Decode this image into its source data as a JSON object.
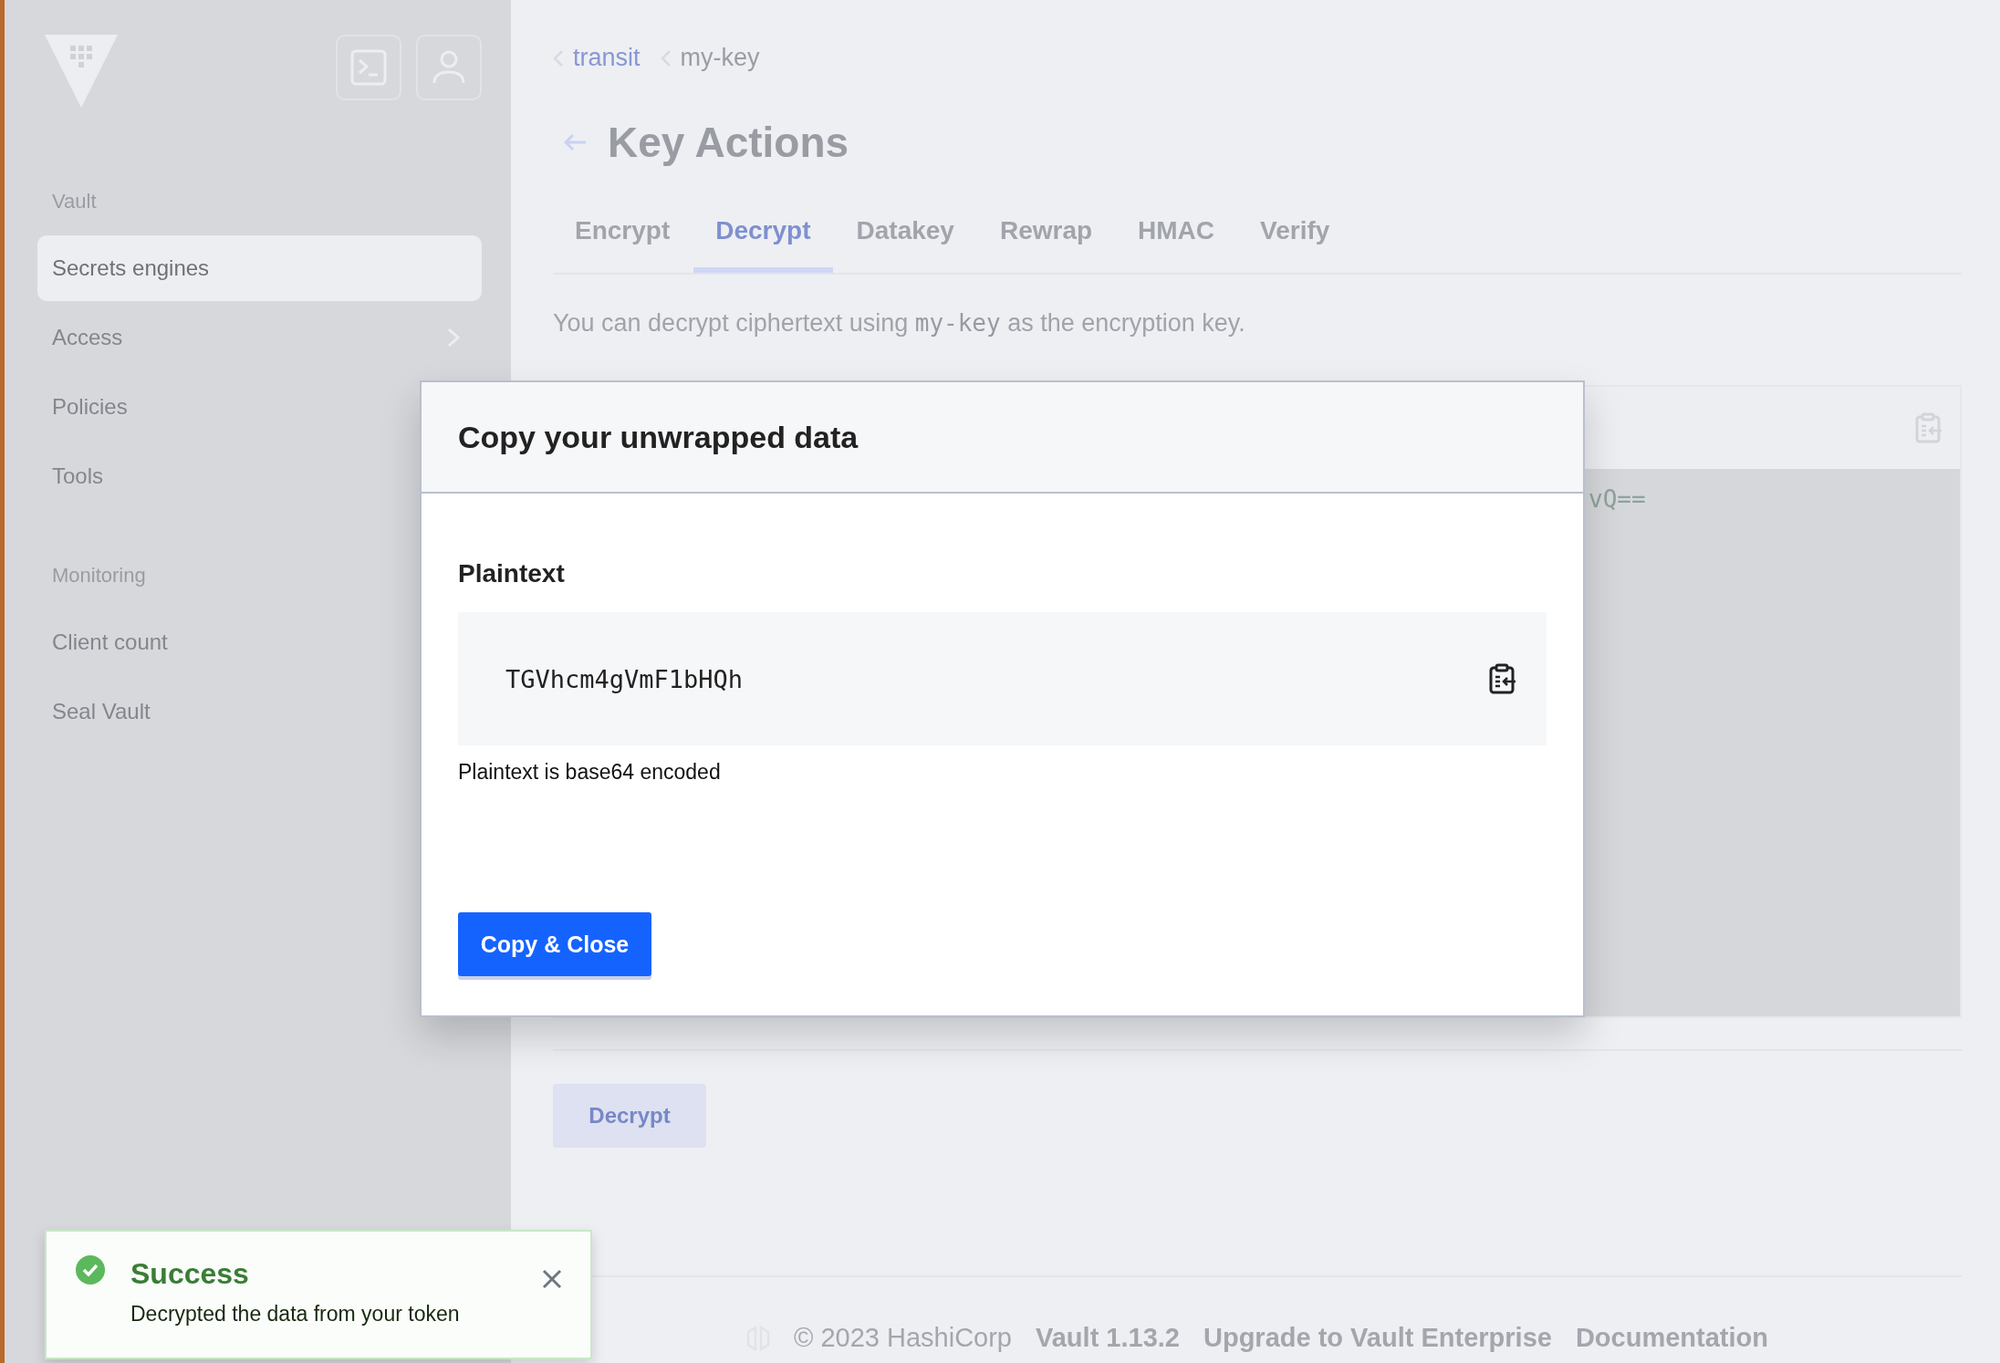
{
  "sidebar": {
    "sections": [
      {
        "heading": "Vault",
        "items": [
          {
            "label": "Secrets engines",
            "selected": true
          },
          {
            "label": "Access",
            "selected": false,
            "has_submenu": true
          },
          {
            "label": "Policies",
            "selected": false
          },
          {
            "label": "Tools",
            "selected": false
          }
        ]
      },
      {
        "heading": "Monitoring",
        "items": [
          {
            "label": "Client count",
            "selected": false
          },
          {
            "label": "Seal Vault",
            "selected": false
          }
        ]
      }
    ]
  },
  "breadcrumbs": [
    "transit",
    "my-key"
  ],
  "page_title": "Key Actions",
  "tabs": [
    {
      "label": "Encrypt",
      "selected": false
    },
    {
      "label": "Decrypt",
      "selected": true
    },
    {
      "label": "Datakey",
      "selected": false
    },
    {
      "label": "Rewrap",
      "selected": false
    },
    {
      "label": "HMAC",
      "selected": false
    },
    {
      "label": "Verify",
      "selected": false
    }
  ],
  "description": {
    "before": "You can decrypt ciphertext using",
    "key": "my-key",
    "after": "as the encryption key."
  },
  "ciphertext_visible": "vQ==",
  "decrypt_button": "Decrypt",
  "footer": {
    "copyright": "© 2023 HashiCorp",
    "version": "Vault 1.13.2",
    "links": [
      "Upgrade to Vault Enterprise",
      "Documentation"
    ]
  },
  "modal": {
    "title": "Copy your unwrapped data",
    "field_label": "Plaintext",
    "value": "TGVhcm4gVmF1bHQh",
    "help": "Plaintext is base64 encoded",
    "button": "Copy & Close"
  },
  "toast": {
    "title": "Success",
    "message": "Decrypted the data from your token"
  }
}
